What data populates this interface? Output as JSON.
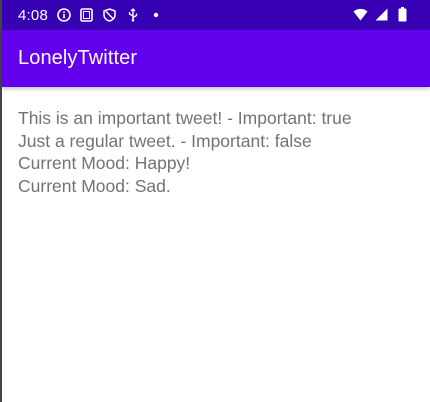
{
  "status_bar": {
    "time": "4:08",
    "left_icons": [
      "info-circle-icon",
      "screenshot-icon",
      "shield-icon",
      "usb-icon",
      "notification-dot-icon"
    ],
    "right_icons": [
      "wifi-icon",
      "cellular-signal-icon",
      "battery-icon"
    ],
    "background": "#3700b3"
  },
  "app_bar": {
    "title": "LonelyTwitter",
    "background": "#6200ee"
  },
  "tweets": [
    "This is an important tweet! - Important: true",
    "Just a regular tweet. - Important: false",
    "Current Mood: Happy!",
    "Current Mood: Sad."
  ],
  "colors": {
    "text": "#737373",
    "background": "#ffffff"
  }
}
